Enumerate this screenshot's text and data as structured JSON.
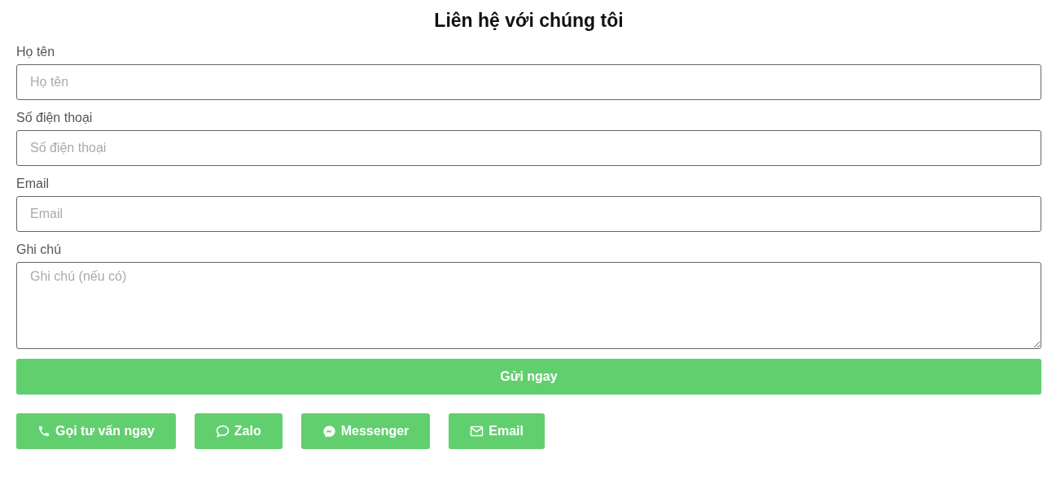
{
  "title": "Liên hệ với chúng tôi",
  "fields": [
    {
      "kind": "input",
      "label": "Họ tên",
      "placeholder": "Họ tên"
    },
    {
      "kind": "input",
      "label": "Số điện thoại",
      "placeholder": "Số điện thoại"
    },
    {
      "kind": "input",
      "label": "Email",
      "placeholder": "Email"
    },
    {
      "kind": "textarea",
      "label": "Ghi chú",
      "placeholder": "Ghi chú (nếu có)"
    }
  ],
  "submit": "Gửi ngay",
  "contacts": [
    {
      "kind": "phone",
      "label": "Gọi tư vấn ngay"
    },
    {
      "kind": "chat",
      "label": "Zalo"
    },
    {
      "kind": "messenger",
      "label": "Messenger"
    },
    {
      "kind": "mail",
      "label": "Email"
    }
  ]
}
